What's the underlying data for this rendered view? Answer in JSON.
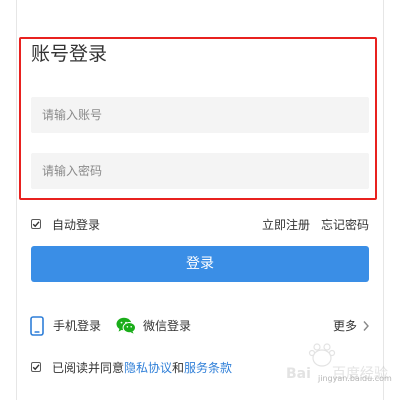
{
  "login_form": {
    "title": "账号登录",
    "account_placeholder": "请输入账号",
    "password_placeholder": "请输入密码"
  },
  "options": {
    "auto_login_label": "自动登录",
    "auto_login_checked": true,
    "register_label": "立即注册",
    "forgot_password_label": "忘记密码"
  },
  "login_button": {
    "label": "登录"
  },
  "alt_login": {
    "phone": {
      "label": "手机登录",
      "icon": "phone-icon"
    },
    "wechat": {
      "label": "微信登录",
      "icon": "wechat-icon"
    },
    "more_label": "更多"
  },
  "agreement": {
    "checked": true,
    "prefix": "已阅读并同意",
    "privacy_label": "隐私协议",
    "and": "和",
    "terms_label": "服务条款"
  },
  "colors": {
    "accent": "#3a8ee6",
    "link": "#2f7fd8",
    "highlight": "#e8211f"
  },
  "watermark": {
    "logo_text": "Bai百度经验",
    "url_text": "jingyan.baidu.com"
  }
}
